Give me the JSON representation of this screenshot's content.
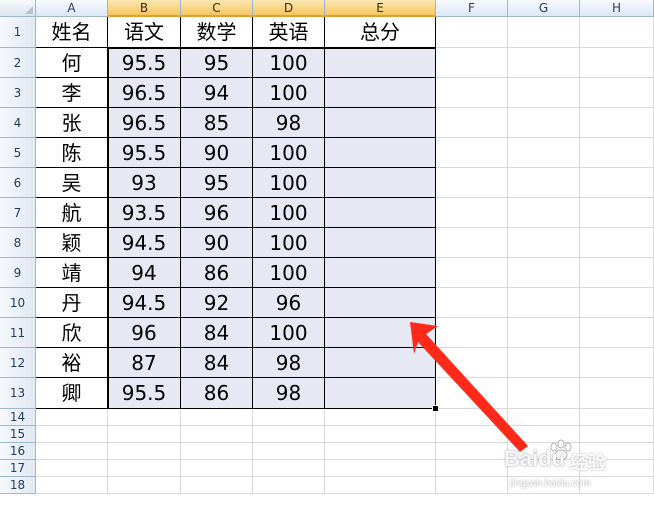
{
  "columns": [
    "A",
    "B",
    "C",
    "D",
    "E",
    "F",
    "G",
    "H"
  ],
  "row_numbers": [
    "1",
    "2",
    "3",
    "4",
    "5",
    "6",
    "7",
    "8",
    "9",
    "10",
    "11",
    "12",
    "13",
    "14",
    "15",
    "16",
    "17",
    "18"
  ],
  "header_row": [
    "姓名",
    "语文",
    "数学",
    "英语",
    "总分"
  ],
  "rows": [
    [
      "何",
      "95.5",
      "95",
      "100",
      ""
    ],
    [
      "李",
      "96.5",
      "94",
      "100",
      ""
    ],
    [
      "张",
      "96.5",
      "85",
      "98",
      ""
    ],
    [
      "陈",
      "95.5",
      "90",
      "100",
      ""
    ],
    [
      "吴",
      "93",
      "95",
      "100",
      ""
    ],
    [
      "航",
      "93.5",
      "96",
      "100",
      ""
    ],
    [
      "颖",
      "94.5",
      "90",
      "100",
      ""
    ],
    [
      "靖",
      "94",
      "86",
      "100",
      ""
    ],
    [
      "丹",
      "94.5",
      "92",
      "96",
      ""
    ],
    [
      "欣",
      "96",
      "84",
      "100",
      ""
    ],
    [
      "裕",
      "87",
      "84",
      "98",
      ""
    ],
    [
      "卿",
      "95.5",
      "86",
      "98",
      ""
    ]
  ],
  "selection": {
    "range": "B2:E13",
    "selected_columns": [
      "B",
      "C",
      "D",
      "E"
    ]
  },
  "colors": {
    "selection_fill": "#e6e8f3",
    "arrow": "#ff2a1a",
    "header_selected": "#f6c660"
  },
  "watermark": {
    "logo": "Baidu",
    "brand": "经验",
    "url": "jingyan.baidu.com"
  }
}
